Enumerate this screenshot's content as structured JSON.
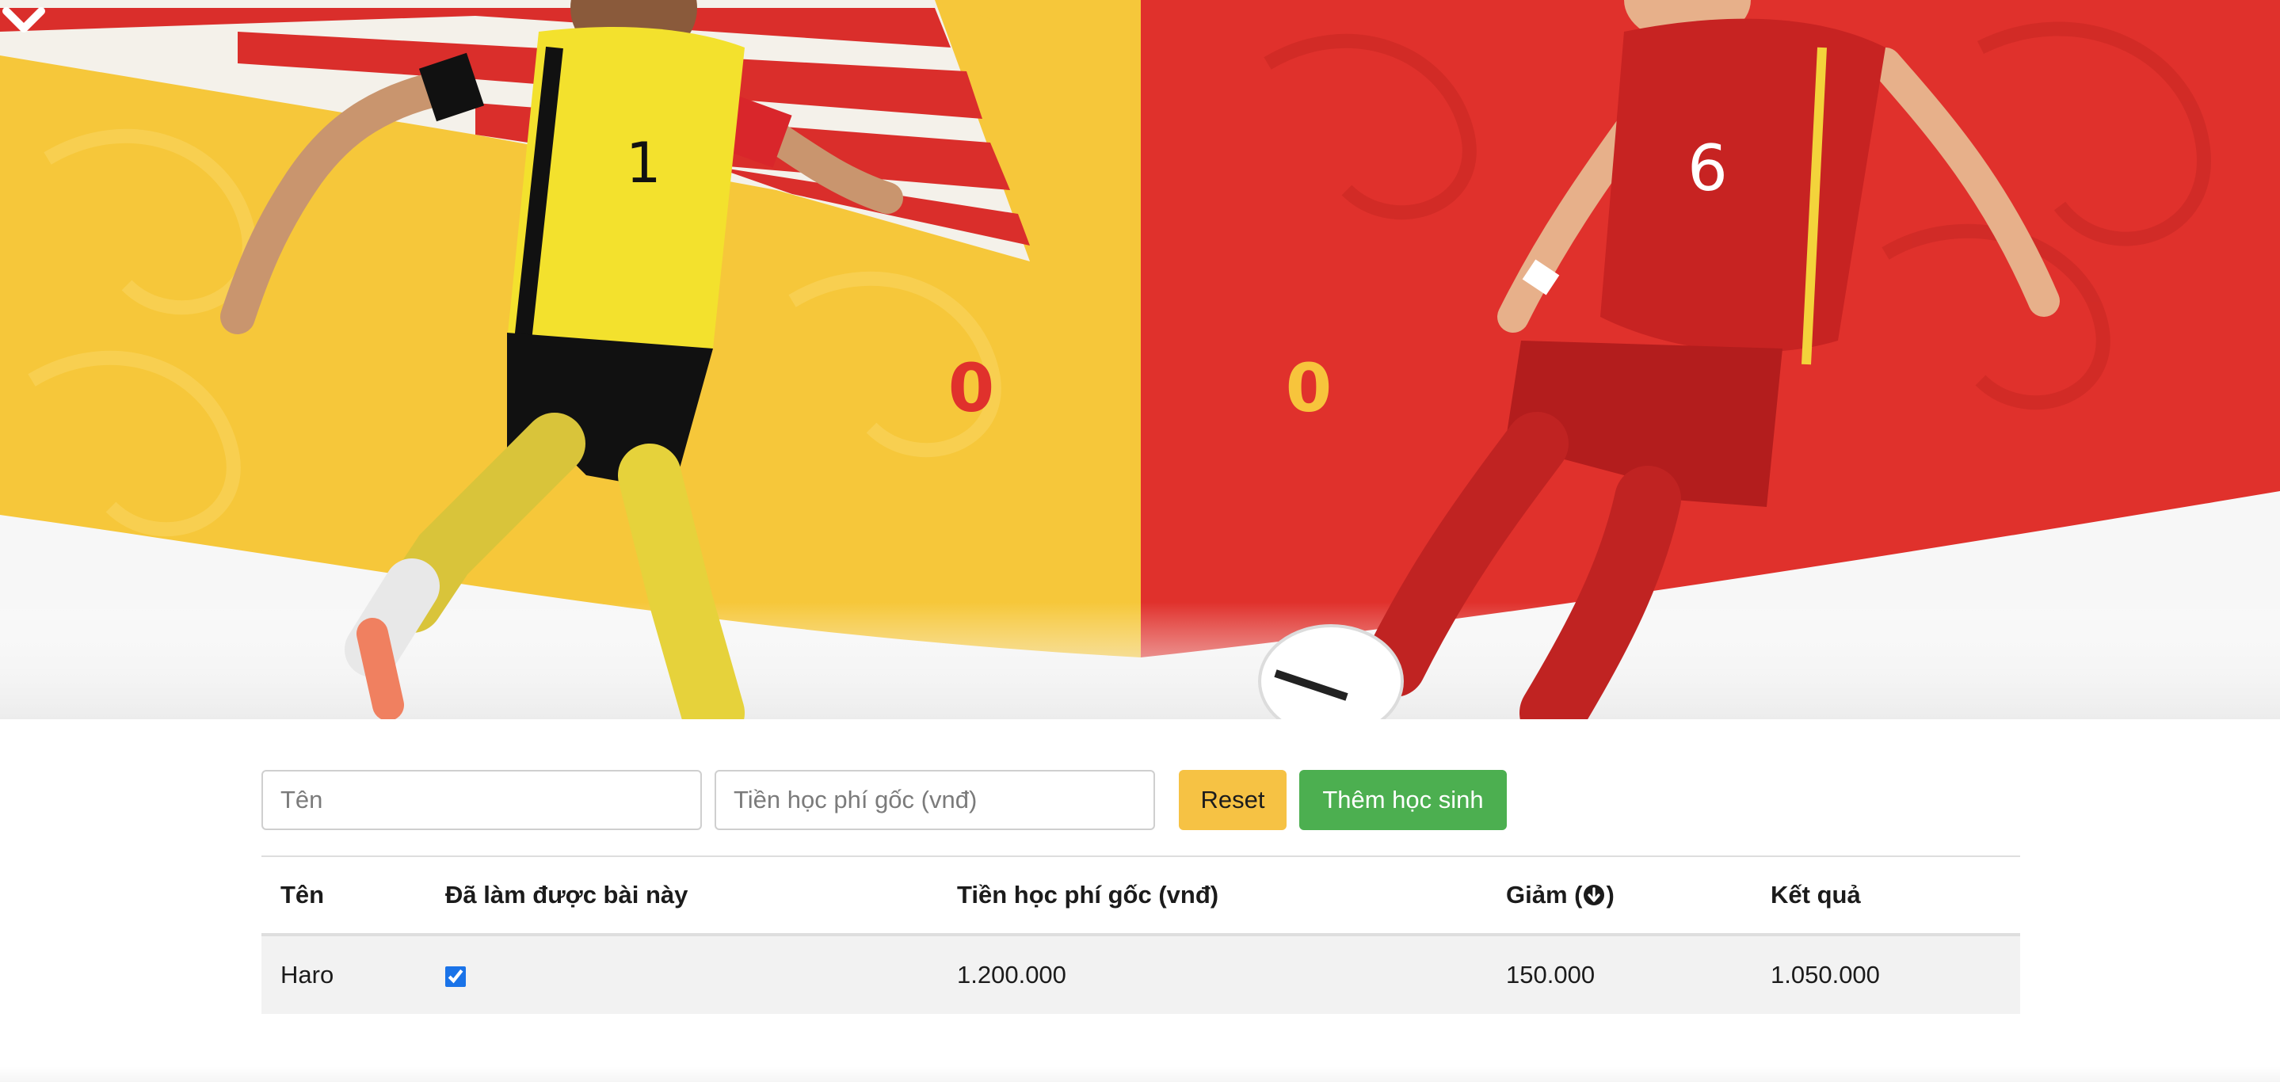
{
  "hero": {
    "left_score": "0",
    "right_score": "0",
    "left_team_color": "#f6c73a",
    "right_team_color": "#e0312c",
    "left_player_jersey": "1",
    "right_player_jersey": "6",
    "toggle_icon": "chevron-down-icon"
  },
  "form": {
    "name_placeholder": "Tên",
    "name_value": "",
    "fee_placeholder": "Tiền học phí gốc (vnđ)",
    "fee_value": "",
    "reset_label": "Reset",
    "add_label": "Thêm học sinh",
    "reset_color": "#f6c244",
    "add_color": "#4caf50"
  },
  "table": {
    "headers": {
      "name": "Tên",
      "done": "Đã làm được bài này",
      "fee": "Tiền học phí gốc (vnđ)",
      "discount": "Giảm",
      "discount_sort_icon": "arrow-down-circle-icon",
      "result": "Kết quả"
    },
    "rows": [
      {
        "name": "Haro",
        "done": true,
        "fee": "1.200.000",
        "discount": "150.000",
        "result": "1.050.000"
      }
    ]
  }
}
